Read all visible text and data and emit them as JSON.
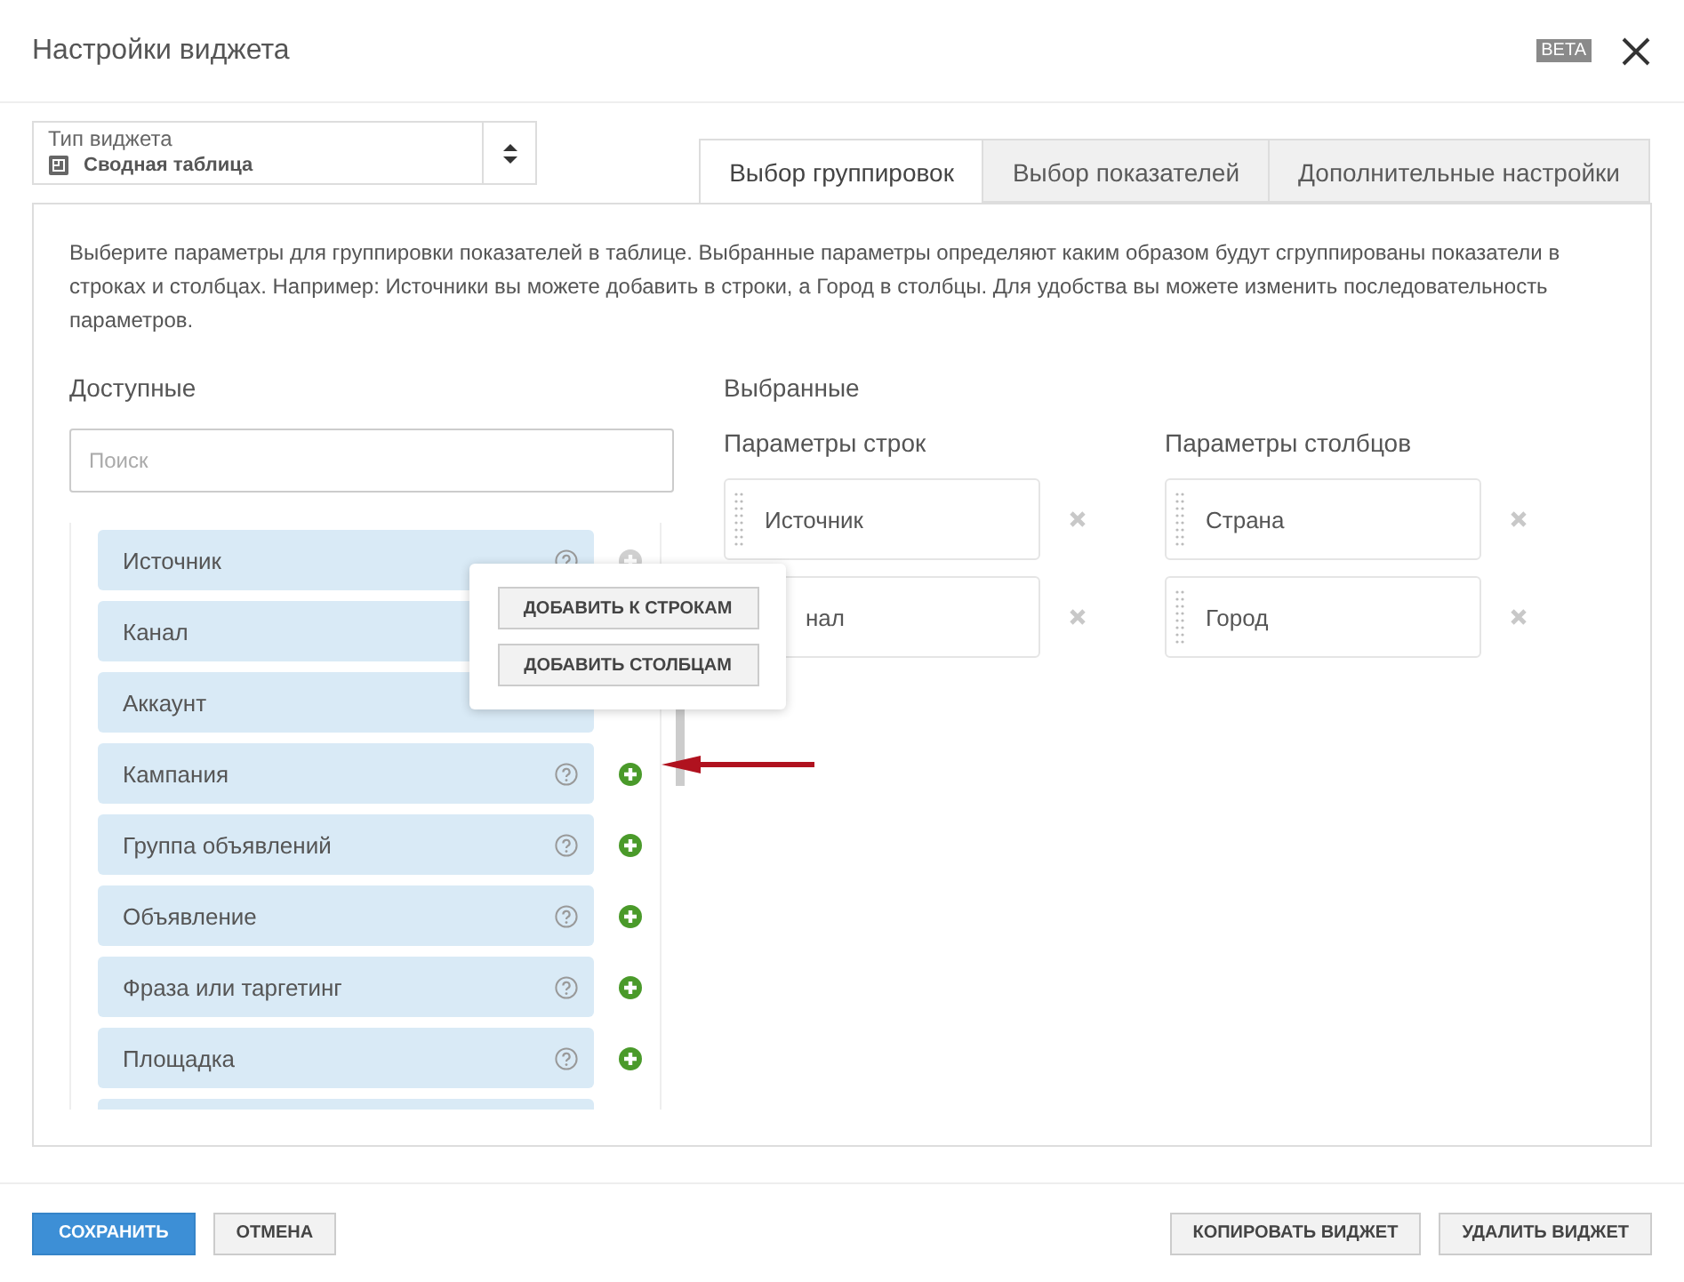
{
  "window": {
    "title": "Настройки виджета",
    "badge": "BETA"
  },
  "widget_type": {
    "label": "Тип виджета",
    "value": "Сводная таблица"
  },
  "tabs": [
    {
      "label": "Выбор группировок",
      "selected": true
    },
    {
      "label": "Выбор показателей",
      "selected": false
    },
    {
      "label": "Дополнительные настройки",
      "selected": false
    }
  ],
  "description": "Выберите параметры для группировки показателей в таблице. Выбранные параметры определяют каким образом будут сгруппированы показатели в строках и столбцах. Например: Источники вы можете добавить в строки, а Город в столбцы. Для удобства вы можете изменить последовательность параметров.",
  "available": {
    "title": "Доступные",
    "search": {
      "placeholder": "Поиск"
    },
    "items": [
      {
        "label": "Источник",
        "added": true,
        "covered": false
      },
      {
        "label": "Канал",
        "covered": true
      },
      {
        "label": "Аккаунт",
        "covered": true
      },
      {
        "label": "Кампания",
        "added": false,
        "covered": false
      },
      {
        "label": "Группа объявлений",
        "added": false,
        "covered": false
      },
      {
        "label": "Объявление",
        "added": false,
        "covered": false
      },
      {
        "label": "Фраза или таргетинг",
        "added": false,
        "covered": false
      },
      {
        "label": "Площадка",
        "added": false,
        "covered": false
      },
      {
        "covered": true
      }
    ]
  },
  "selected": {
    "title": "Выбранные",
    "columns": [
      {
        "title": "Параметры строк",
        "items": [
          {
            "label": "Источник",
            "covered": false
          },
          {
            "label": "нал",
            "covered": true
          }
        ]
      },
      {
        "title": "Параметры столбцов",
        "items": [
          {
            "label": "Страна",
            "covered": false
          },
          {
            "label": "Город",
            "covered": false
          }
        ]
      }
    ]
  },
  "popover": {
    "buttons": [
      "ДОБАВИТЬ К СТРОКАМ",
      "ДОБАВИТЬ СТОЛБЦАМ"
    ]
  },
  "footer": {
    "left": [
      {
        "label": "СОХРАНИТЬ",
        "kind": "primary"
      },
      {
        "label": "ОТМЕНА",
        "kind": "plain"
      }
    ],
    "right": [
      {
        "label": "КОПИРОВАТЬ ВИДЖЕТ",
        "kind": "plain"
      },
      {
        "label": "УДАЛИТЬ ВИДЖЕТ",
        "kind": "plain"
      }
    ]
  }
}
